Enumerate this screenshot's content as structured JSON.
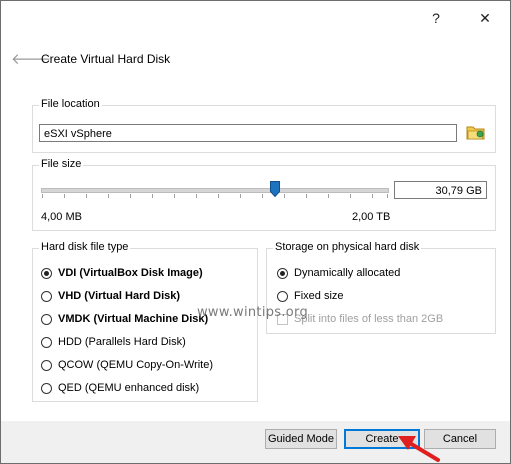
{
  "window": {
    "help_label": "?",
    "close_label": "✕",
    "back_icon": "back-arrow-icon",
    "title": "Create Virtual Hard Disk"
  },
  "file_location": {
    "label": "File location",
    "value": "eSXI vSphere",
    "icon": "folder-icon"
  },
  "file_size": {
    "label": "File size",
    "value": "30,79 GB",
    "min_label": "4,00 MB",
    "max_label": "2,00 TB"
  },
  "disk_type": {
    "label": "Hard disk file type",
    "options": [
      {
        "label": "VDI (VirtualBox Disk Image)",
        "checked": true,
        "bold": true
      },
      {
        "label": "VHD (Virtual Hard Disk)",
        "checked": false,
        "bold": true
      },
      {
        "label": "VMDK (Virtual Machine Disk)",
        "checked": false,
        "bold": true
      },
      {
        "label": "HDD (Parallels Hard Disk)",
        "checked": false,
        "bold": false
      },
      {
        "label": "QCOW (QEMU Copy-On-Write)",
        "checked": false,
        "bold": false
      },
      {
        "label": "QED (QEMU enhanced disk)",
        "checked": false,
        "bold": false
      }
    ]
  },
  "storage": {
    "label": "Storage on physical hard disk",
    "dynamic_label": "Dynamically allocated",
    "fixed_label": "Fixed size",
    "split_label": "Split into files of less than 2GB"
  },
  "buttons": {
    "guided_mode": "Guided Mode",
    "create": "Create",
    "cancel": "Cancel"
  },
  "watermark": "www.wintips.org",
  "colors": {
    "accent": "#0078d7",
    "slider_handle": "#1e73be",
    "annotation_arrow": "#e02020"
  }
}
